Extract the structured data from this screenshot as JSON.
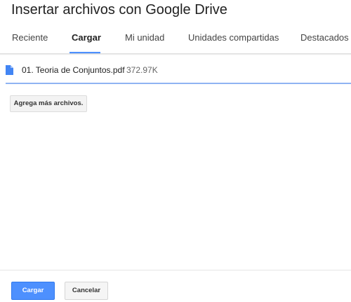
{
  "dialog": {
    "title": "Insertar archivos con Google Drive"
  },
  "tabs": [
    {
      "label": "Reciente",
      "active": false
    },
    {
      "label": "Cargar",
      "active": true
    },
    {
      "label": "Mi unidad",
      "active": false
    },
    {
      "label": "Unidades compartidas",
      "active": false
    },
    {
      "label": "Destacados",
      "active": false
    }
  ],
  "upload": {
    "file": {
      "icon": "document-icon",
      "name": "01. Teoria de Conjuntos.pdf",
      "size": "372.97K",
      "progress": 1.0
    },
    "add_more_label": "Agrega más archivos."
  },
  "footer": {
    "primary_label": "Cargar",
    "secondary_label": "Cancelar"
  },
  "colors": {
    "accent": "#4d90fe",
    "progress": "#8fb4f3",
    "file_icon": "#4285f4"
  }
}
